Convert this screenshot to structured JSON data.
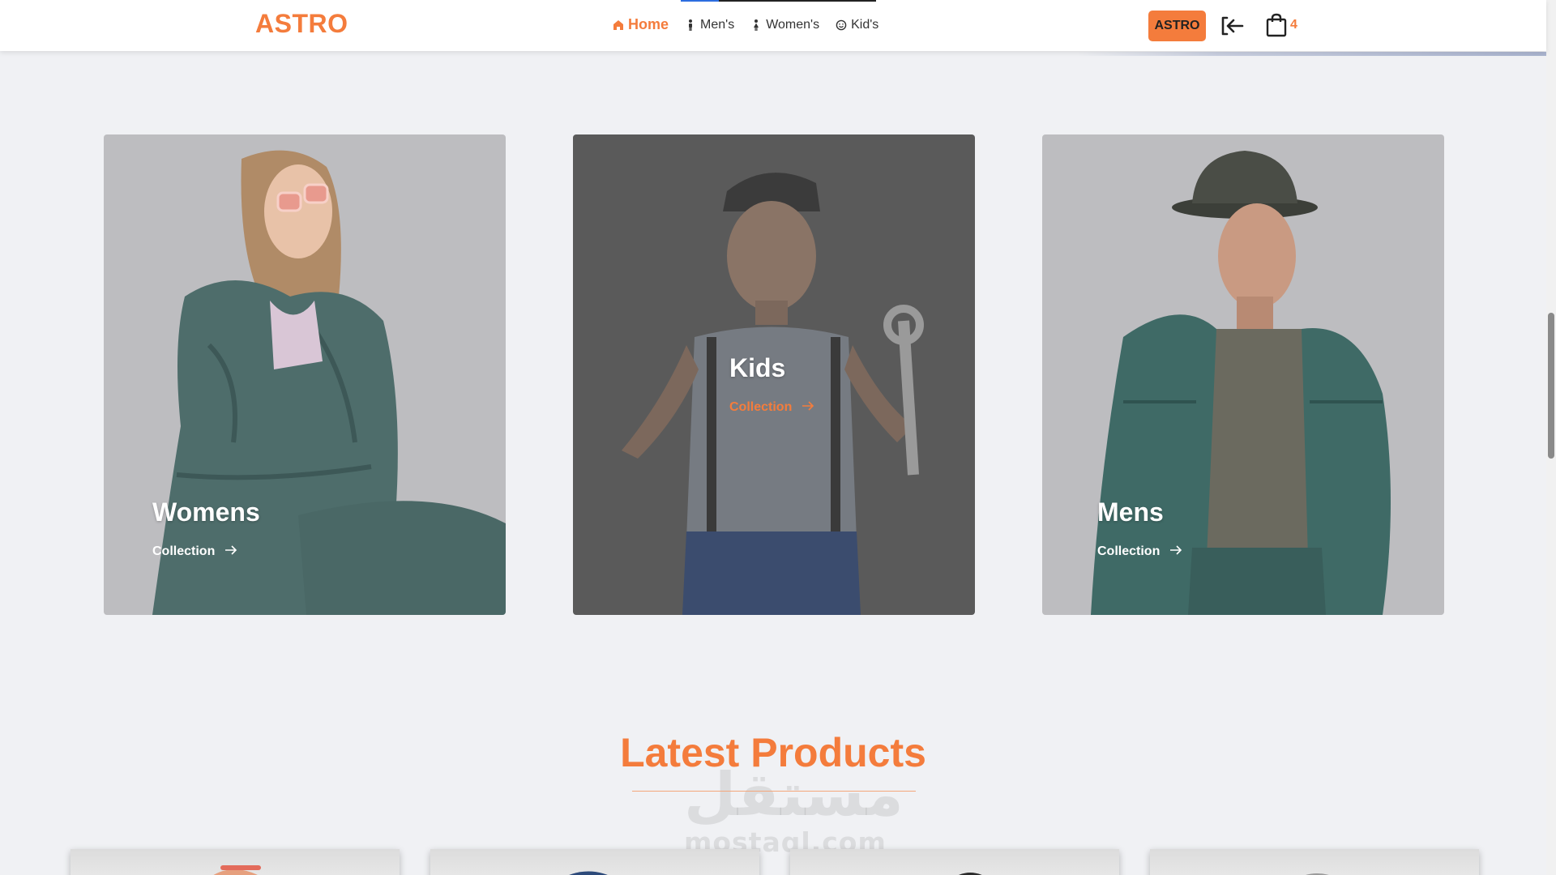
{
  "brand": {
    "logo_text": "ASTRO",
    "accent_color": "#f47c3c"
  },
  "nav": {
    "items": [
      {
        "label": "Home",
        "icon": "home-icon",
        "active": true
      },
      {
        "label": "Men's",
        "icon": "male-icon",
        "active": false
      },
      {
        "label": "Women's",
        "icon": "female-icon",
        "active": false
      },
      {
        "label": "Kid's",
        "icon": "smile-icon",
        "active": false
      }
    ]
  },
  "header_actions": {
    "brand_button_label": "ASTRO",
    "login_icon": "login-arrow-icon",
    "cart_icon": "shopping-bag-icon",
    "cart_count": "4"
  },
  "collections": [
    {
      "title": "Womens",
      "link_label": "Collection",
      "link_icon": "arrow-right-icon"
    },
    {
      "title": "Kids",
      "link_label": "Collection",
      "link_icon": "arrow-right-icon"
    },
    {
      "title": "Mens",
      "link_label": "Collection",
      "link_icon": "arrow-right-icon"
    }
  ],
  "latest": {
    "title": "Latest Products"
  },
  "watermark": {
    "text_arabic": "مستقل",
    "text_latin": "mostaql.com"
  }
}
